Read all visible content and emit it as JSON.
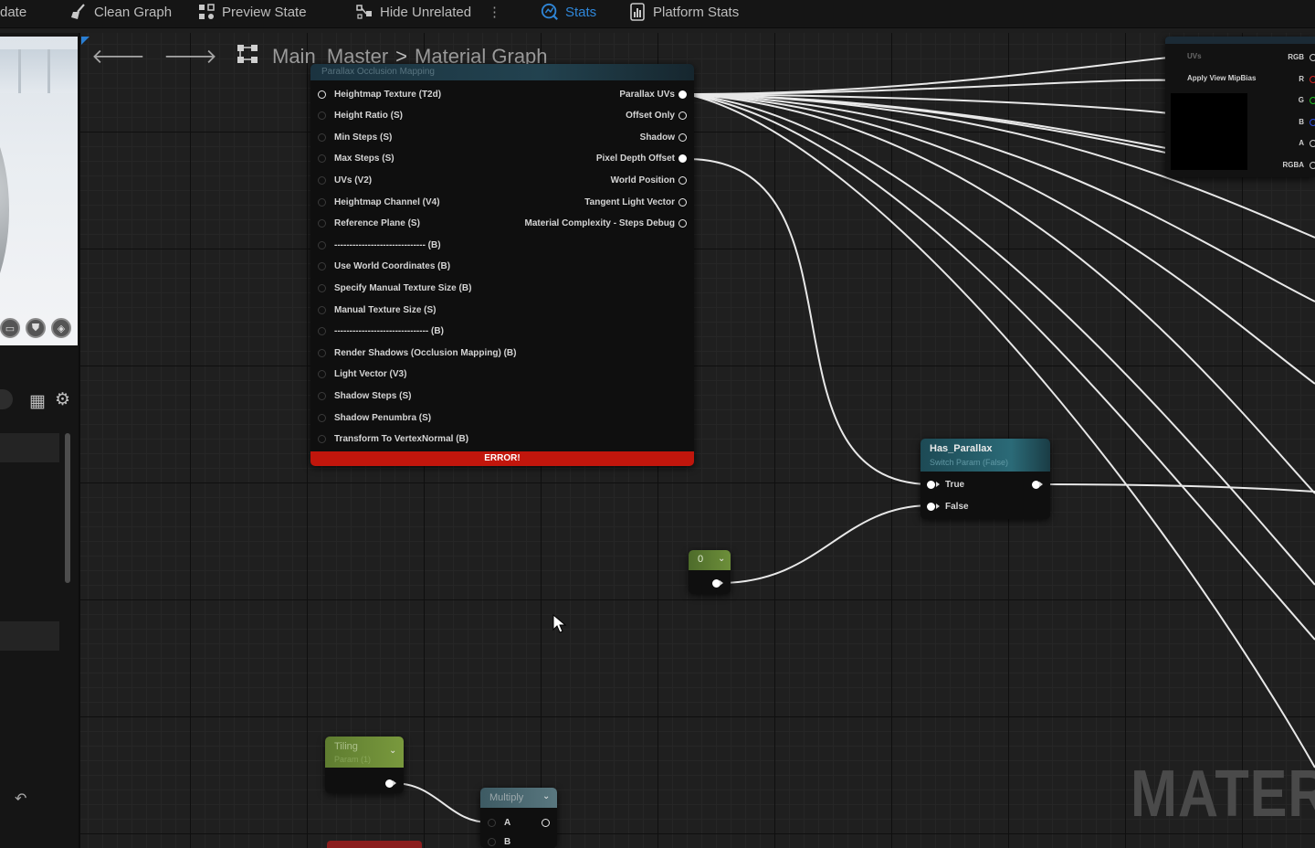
{
  "toolbar": {
    "items": [
      {
        "label": "date",
        "icon": "update-icon"
      },
      {
        "label": "Clean Graph",
        "icon": "broom-icon"
      },
      {
        "label": "Preview State",
        "icon": "preview-state-icon"
      },
      {
        "label": "Hide Unrelated",
        "icon": "hide-unrelated-icon"
      },
      {
        "label": "Stats",
        "icon": "stats-icon",
        "active": true
      },
      {
        "label": "Platform Stats",
        "icon": "platform-stats-icon"
      }
    ],
    "accent": "#2f86d8"
  },
  "breadcrumb": {
    "root": "Main_Master",
    "separator": ">",
    "current": "Material Graph"
  },
  "main_node": {
    "title": "Parallax Occlusion Mapping",
    "inputs": [
      "Heightmap Texture (T2d)",
      "Height Ratio (S)",
      "Min Steps (S)",
      "Max Steps (S)",
      "UVs (V2)",
      "Heightmap Channel (V4)",
      "Reference Plane (S)",
      "------------------------------ (B)",
      "Use World Coordinates (B)",
      "Specify Manual Texture Size (B)",
      "Manual Texture Size (S)",
      "------------------------------- (B)",
      "Render Shadows (Occlusion Mapping) (B)",
      "Light Vector (V3)",
      "Shadow Steps (S)",
      "Shadow Penumbra (S)",
      "Transform To VertexNormal (B)"
    ],
    "outputs": [
      "Parallax UVs",
      "Offset Only",
      "Shadow",
      "Pixel Depth Offset",
      "World Position",
      "Tangent Light Vector",
      "Material Complexity - Steps Debug"
    ],
    "error": "ERROR!",
    "error_color": "#c1160c"
  },
  "switch_node": {
    "title": "Has_Parallax",
    "subtitle": "Switch Param (False)",
    "inputs": [
      "True",
      "False"
    ]
  },
  "constant_node": {
    "value": "0"
  },
  "tiling_node": {
    "title": "Tiling",
    "subtitle": "Param (1)"
  },
  "multiply_node": {
    "title": "Multiply",
    "inputs": [
      "A",
      "B"
    ]
  },
  "texture_node": {
    "inputs": [
      "UVs",
      "Apply View MipBias"
    ],
    "outputs": [
      "RGB",
      "R",
      "G",
      "B",
      "A",
      "RGBA"
    ],
    "pin_colors": {
      "RGB": "#cccccc",
      "R": "#d42020",
      "G": "#20c020",
      "B": "#3050e0",
      "A": "#cccccc",
      "RGBA": "#cccccc"
    }
  },
  "watermark": "MATER"
}
